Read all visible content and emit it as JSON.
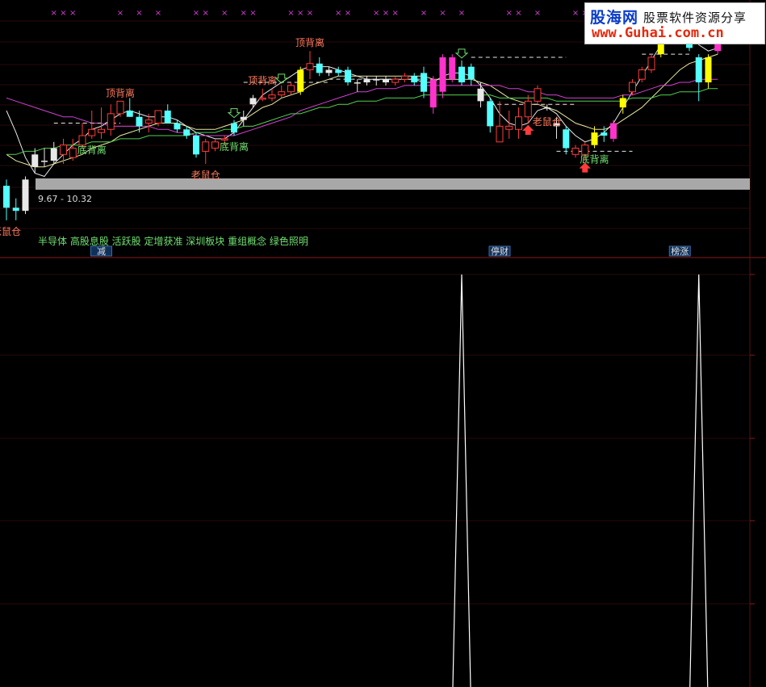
{
  "watermark": {
    "brand": "股海网",
    "tagline": "股票软件资源分享",
    "url": "www.Guhai.com.cn"
  },
  "colors": {
    "background": "#000000",
    "candle_up": "#ff3b3b",
    "candle_down": "#54ffff",
    "candle_strong_up": "#ff33cc",
    "candle_strong_down": "#ffff00",
    "label_red": "#ff7a5c",
    "label_green": "#6fe06f",
    "ma_white": "#e8e8e8",
    "ma_yellow": "#e8e89a",
    "ma_magenta": "#d040d0",
    "ma_green": "#4ed04e",
    "marker_magenta": "#d63bd6",
    "price_band": "#a8a8a8"
  },
  "chart_data": [
    {
      "type": "candlestick",
      "range_label": "9.67 - 10.32",
      "concepts_text": "半导体 高股息股 活跃股 定增获准 深圳板块 重组概念 绿色照明",
      "event_labels": [
        {
          "text": "减",
          "bar": 10,
          "color": "#e0e0e0"
        },
        {
          "text": "停财",
          "bar": 52,
          "color": "#e0e0e0"
        },
        {
          "text": "榜涨",
          "bar": 71,
          "color": "#e0e0e0"
        }
      ],
      "annotations": [
        {
          "text": "顶背离",
          "bar": 12,
          "side": "above",
          "color": "#ff7a5c"
        },
        {
          "text": "顶背离",
          "bar": 27,
          "side": "above",
          "color": "#ff7a5c"
        },
        {
          "text": "顶背离",
          "bar": 32,
          "side": "above",
          "color": "#ff7a5c"
        },
        {
          "text": "底背离",
          "bar": 9,
          "side": "below",
          "color": "#6fe06f"
        },
        {
          "text": "底背离",
          "bar": 24,
          "side": "below",
          "color": "#6fe06f"
        },
        {
          "text": "底背离",
          "bar": 62,
          "side": "below",
          "color": "#6fe06f"
        },
        {
          "text": "老鼠仓",
          "bar": 0,
          "side": "below",
          "color": "#ff7a5c"
        },
        {
          "text": "老鼠仓",
          "bar": 21,
          "side": "below",
          "color": "#ff7a5c"
        },
        {
          "text": "老鼠仓",
          "bar": 57,
          "side": "below",
          "color": "#ff7a5c"
        }
      ],
      "top_marker_bars": [
        5,
        6,
        7,
        12,
        14,
        16,
        20,
        21,
        23,
        25,
        26,
        30,
        31,
        32,
        35,
        36,
        39,
        40,
        41,
        44,
        46,
        48,
        53,
        54,
        56,
        60,
        61,
        66,
        67,
        68,
        69,
        71,
        72,
        73
      ],
      "candles": [
        {
          "o": 9.78,
          "h": 9.8,
          "l": 9.67,
          "c": 9.71,
          "k": "down"
        },
        {
          "o": 9.71,
          "h": 9.74,
          "l": 9.67,
          "c": 9.7,
          "k": "down"
        },
        {
          "o": 9.7,
          "h": 9.81,
          "l": 9.69,
          "c": 9.8,
          "k": "doji"
        },
        {
          "o": 9.84,
          "h": 9.9,
          "l": 9.82,
          "c": 9.88,
          "k": "doji"
        },
        {
          "o": 9.86,
          "h": 9.9,
          "l": 9.84,
          "c": 9.86,
          "k": "doji"
        },
        {
          "o": 9.86,
          "h": 9.92,
          "l": 9.85,
          "c": 9.9,
          "k": "doji"
        },
        {
          "o": 9.88,
          "h": 9.93,
          "l": 9.85,
          "c": 9.91,
          "k": "up"
        },
        {
          "o": 9.87,
          "h": 9.93,
          "l": 9.86,
          "c": 9.9,
          "k": "up"
        },
        {
          "o": 9.91,
          "h": 9.98,
          "l": 9.9,
          "c": 9.94,
          "k": "up"
        },
        {
          "o": 9.94,
          "h": 10.02,
          "l": 9.93,
          "c": 9.96,
          "k": "up"
        },
        {
          "o": 9.96,
          "h": 10.03,
          "l": 9.93,
          "c": 9.95,
          "k": "up"
        },
        {
          "o": 9.96,
          "h": 10.04,
          "l": 9.94,
          "c": 10.01,
          "k": "up"
        },
        {
          "o": 10.01,
          "h": 10.05,
          "l": 10.0,
          "c": 10.05,
          "k": "up"
        },
        {
          "o": 10.02,
          "h": 10.06,
          "l": 10.0,
          "c": 10.0,
          "k": "down"
        },
        {
          "o": 10.0,
          "h": 10.02,
          "l": 9.95,
          "c": 9.97,
          "k": "down"
        },
        {
          "o": 9.98,
          "h": 10.01,
          "l": 9.95,
          "c": 9.99,
          "k": "up"
        },
        {
          "o": 9.98,
          "h": 10.02,
          "l": 9.97,
          "c": 10.02,
          "k": "up"
        },
        {
          "o": 10.02,
          "h": 10.04,
          "l": 9.98,
          "c": 9.98,
          "k": "down"
        },
        {
          "o": 9.98,
          "h": 9.99,
          "l": 9.95,
          "c": 9.96,
          "k": "down"
        },
        {
          "o": 9.96,
          "h": 9.97,
          "l": 9.93,
          "c": 9.94,
          "k": "down"
        },
        {
          "o": 9.94,
          "h": 9.95,
          "l": 9.87,
          "c": 9.88,
          "k": "down"
        },
        {
          "o": 9.89,
          "h": 9.93,
          "l": 9.85,
          "c": 9.92,
          "k": "up"
        },
        {
          "o": 9.9,
          "h": 9.93,
          "l": 9.89,
          "c": 9.92,
          "k": "up"
        },
        {
          "o": 9.93,
          "h": 9.94,
          "l": 9.91,
          "c": 9.93,
          "k": "up"
        },
        {
          "o": 9.95,
          "h": 9.99,
          "l": 9.94,
          "c": 9.98,
          "k": "down"
        },
        {
          "o": 9.99,
          "h": 10.02,
          "l": 9.97,
          "c": 10.0,
          "k": "doji"
        },
        {
          "o": 10.04,
          "h": 10.07,
          "l": 10.03,
          "c": 10.06,
          "k": "doji"
        },
        {
          "o": 10.06,
          "h": 10.09,
          "l": 10.05,
          "c": 10.06,
          "k": "up"
        },
        {
          "o": 10.06,
          "h": 10.09,
          "l": 10.05,
          "c": 10.07,
          "k": "up"
        },
        {
          "o": 10.07,
          "h": 10.1,
          "l": 10.06,
          "c": 10.08,
          "k": "up"
        },
        {
          "o": 10.08,
          "h": 10.11,
          "l": 10.07,
          "c": 10.1,
          "k": "up"
        },
        {
          "o": 10.08,
          "h": 10.16,
          "l": 10.07,
          "c": 10.15,
          "k": "strong_down"
        },
        {
          "o": 10.15,
          "h": 10.21,
          "l": 10.12,
          "c": 10.17,
          "k": "up"
        },
        {
          "o": 10.17,
          "h": 10.19,
          "l": 10.13,
          "c": 10.14,
          "k": "down"
        },
        {
          "o": 10.14,
          "h": 10.16,
          "l": 10.13,
          "c": 10.15,
          "k": "doji"
        },
        {
          "o": 10.15,
          "h": 10.16,
          "l": 10.13,
          "c": 10.14,
          "k": "down"
        },
        {
          "o": 10.15,
          "h": 10.16,
          "l": 10.1,
          "c": 10.11,
          "k": "down"
        },
        {
          "o": 10.11,
          "h": 10.12,
          "l": 10.08,
          "c": 10.11,
          "k": "doji"
        },
        {
          "o": 10.11,
          "h": 10.13,
          "l": 10.1,
          "c": 10.12,
          "k": "doji"
        },
        {
          "o": 10.12,
          "h": 10.13,
          "l": 10.1,
          "c": 10.12,
          "k": "doji"
        },
        {
          "o": 10.12,
          "h": 10.13,
          "l": 10.1,
          "c": 10.11,
          "k": "doji"
        },
        {
          "o": 10.11,
          "h": 10.13,
          "l": 10.1,
          "c": 10.12,
          "k": "up"
        },
        {
          "o": 10.12,
          "h": 10.14,
          "l": 10.11,
          "c": 10.13,
          "k": "up"
        },
        {
          "o": 10.13,
          "h": 10.14,
          "l": 10.1,
          "c": 10.11,
          "k": "down"
        },
        {
          "o": 10.14,
          "h": 10.16,
          "l": 10.06,
          "c": 10.08,
          "k": "down"
        },
        {
          "o": 10.12,
          "h": 10.13,
          "l": 10.01,
          "c": 10.03,
          "k": "strong_up"
        },
        {
          "o": 10.08,
          "h": 10.2,
          "l": 10.06,
          "c": 10.19,
          "k": "strong_up"
        },
        {
          "o": 10.19,
          "h": 10.2,
          "l": 10.11,
          "c": 10.12,
          "k": "strong_up"
        },
        {
          "o": 10.11,
          "h": 10.18,
          "l": 10.1,
          "c": 10.16,
          "k": "down"
        },
        {
          "o": 10.16,
          "h": 10.17,
          "l": 10.1,
          "c": 10.12,
          "k": "down"
        },
        {
          "o": 10.09,
          "h": 10.11,
          "l": 10.03,
          "c": 10.05,
          "k": "doji"
        },
        {
          "o": 10.05,
          "h": 10.06,
          "l": 9.95,
          "c": 9.97,
          "k": "down"
        },
        {
          "o": 9.97,
          "h": 10.05,
          "l": 9.95,
          "c": 9.92,
          "k": "up"
        },
        {
          "o": 9.97,
          "h": 10.02,
          "l": 9.93,
          "c": 9.96,
          "k": "up"
        },
        {
          "o": 9.96,
          "h": 10.03,
          "l": 9.93,
          "c": 10.0,
          "k": "up"
        },
        {
          "o": 10.0,
          "h": 10.07,
          "l": 9.98,
          "c": 10.05,
          "k": "up"
        },
        {
          "o": 10.05,
          "h": 10.1,
          "l": 10.04,
          "c": 10.09,
          "k": "up"
        },
        {
          "o": 10.03,
          "h": 10.04,
          "l": 10.02,
          "c": 10.03,
          "k": "doji"
        },
        {
          "o": 9.98,
          "h": 10.0,
          "l": 9.93,
          "c": 9.97,
          "k": "doji"
        },
        {
          "o": 9.96,
          "h": 9.97,
          "l": 9.88,
          "c": 9.9,
          "k": "down"
        },
        {
          "o": 9.9,
          "h": 9.91,
          "l": 9.87,
          "c": 9.88,
          "k": "up"
        },
        {
          "o": 9.88,
          "h": 9.92,
          "l": 9.86,
          "c": 9.91,
          "k": "up"
        },
        {
          "o": 9.91,
          "h": 9.97,
          "l": 9.9,
          "c": 9.95,
          "k": "strong_down"
        },
        {
          "o": 9.95,
          "h": 9.97,
          "l": 9.92,
          "c": 9.94,
          "k": "down"
        },
        {
          "o": 9.93,
          "h": 9.99,
          "l": 9.92,
          "c": 9.98,
          "k": "strong_up"
        },
        {
          "o": 10.03,
          "h": 10.07,
          "l": 10.01,
          "c": 10.06,
          "k": "strong_down"
        },
        {
          "o": 10.08,
          "h": 10.12,
          "l": 10.07,
          "c": 10.11,
          "k": "up"
        },
        {
          "o": 10.12,
          "h": 10.16,
          "l": 10.11,
          "c": 10.15,
          "k": "up"
        },
        {
          "o": 10.15,
          "h": 10.2,
          "l": 10.14,
          "c": 10.19,
          "k": "up"
        },
        {
          "o": 10.2,
          "h": 10.27,
          "l": 10.19,
          "c": 10.26,
          "k": "strong_down"
        },
        {
          "o": 10.27,
          "h": 10.31,
          "l": 10.24,
          "c": 10.3,
          "k": "up"
        },
        {
          "o": 10.28,
          "h": 10.32,
          "l": 10.25,
          "c": 10.27,
          "k": "up"
        },
        {
          "o": 10.28,
          "h": 10.3,
          "l": 10.21,
          "c": 10.22,
          "k": "down"
        },
        {
          "o": 10.19,
          "h": 10.2,
          "l": 10.05,
          "c": 10.11,
          "k": "down"
        },
        {
          "o": 10.11,
          "h": 10.2,
          "l": 10.09,
          "c": 10.19,
          "k": "strong_down"
        },
        {
          "o": 10.21,
          "h": 10.28,
          "l": 10.2,
          "c": 10.27,
          "k": "strong_up"
        }
      ],
      "moving_averages": [
        {
          "color": "#e8e8e8",
          "values": [
            10.02,
            9.95,
            9.87,
            9.82,
            9.81,
            9.85,
            9.88,
            9.91,
            9.93,
            9.96,
            9.97,
            9.99,
            10.01,
            10.02,
            10.01,
            10.0,
            10.0,
            10.0,
            9.99,
            9.97,
            9.95,
            9.94,
            9.93,
            9.93,
            9.95,
            9.99,
            10.03,
            10.07,
            10.09,
            10.11,
            10.13,
            10.15,
            10.16,
            10.16,
            10.16,
            10.15,
            10.14,
            10.13,
            10.12,
            10.12,
            10.12,
            10.12,
            10.12,
            10.12,
            10.11,
            10.11,
            10.13,
            10.14,
            10.14,
            10.13,
            10.1,
            10.06,
            10.01,
            9.98,
            9.97,
            9.98,
            10.02,
            10.03,
            10.01,
            9.97,
            9.94,
            9.92,
            9.93,
            9.95,
            9.98,
            10.03,
            10.08,
            10.13,
            10.18,
            10.23,
            10.27,
            10.29,
            10.27,
            10.23,
            10.21,
            10.22
          ]
        },
        {
          "color": "#e8e8a0",
          "values": [
            9.88,
            9.86,
            9.85,
            9.84,
            9.84,
            9.85,
            9.86,
            9.87,
            9.88,
            9.9,
            9.91,
            9.92,
            9.94,
            9.95,
            9.96,
            9.97,
            9.98,
            9.98,
            9.98,
            9.97,
            9.96,
            9.96,
            9.96,
            9.97,
            9.98,
            9.99,
            10.01,
            10.03,
            10.04,
            10.06,
            10.07,
            10.08,
            10.1,
            10.11,
            10.12,
            10.13,
            10.13,
            10.13,
            10.13,
            10.13,
            10.13,
            10.13,
            10.13,
            10.13,
            10.13,
            10.12,
            10.12,
            10.12,
            10.12,
            10.12,
            10.11,
            10.1,
            10.08,
            10.06,
            10.05,
            10.04,
            10.04,
            10.03,
            10.02,
            10.0,
            9.98,
            9.97,
            9.96,
            9.96,
            9.97,
            9.99,
            10.01,
            10.03,
            10.06,
            10.09,
            10.12,
            10.15,
            10.17,
            10.18,
            10.19,
            10.2
          ]
        },
        {
          "color": "#d040d0",
          "values": [
            10.06,
            10.05,
            10.04,
            10.03,
            10.02,
            10.01,
            10.0,
            10.0,
            9.99,
            9.98,
            9.98,
            9.97,
            9.97,
            9.97,
            9.97,
            9.97,
            9.96,
            9.96,
            9.95,
            9.95,
            9.94,
            9.94,
            9.94,
            9.94,
            9.94,
            9.95,
            9.96,
            9.97,
            9.98,
            9.99,
            10.0,
            10.02,
            10.03,
            10.04,
            10.05,
            10.06,
            10.07,
            10.08,
            10.08,
            10.09,
            10.09,
            10.09,
            10.1,
            10.1,
            10.1,
            10.1,
            10.1,
            10.1,
            10.1,
            10.1,
            10.1,
            10.1,
            10.1,
            10.09,
            10.09,
            10.08,
            10.08,
            10.07,
            10.07,
            10.06,
            10.06,
            10.06,
            10.06,
            10.06,
            10.06,
            10.07,
            10.07,
            10.08,
            10.09,
            10.1,
            10.1,
            10.11,
            10.11,
            10.12,
            10.12,
            10.12
          ]
        },
        {
          "color": "#4ed04e",
          "values": [
            9.88,
            9.88,
            9.89,
            9.89,
            9.9,
            9.9,
            9.91,
            9.91,
            9.91,
            9.92,
            9.92,
            9.92,
            9.93,
            9.93,
            9.93,
            9.94,
            9.94,
            9.94,
            9.94,
            9.94,
            9.95,
            9.95,
            9.95,
            9.96,
            9.96,
            9.97,
            9.97,
            9.98,
            9.99,
            10.0,
            10.01,
            10.01,
            10.02,
            10.03,
            10.03,
            10.04,
            10.04,
            10.05,
            10.05,
            10.05,
            10.06,
            10.06,
            10.06,
            10.06,
            10.07,
            10.07,
            10.07,
            10.07,
            10.07,
            10.07,
            10.07,
            10.07,
            10.06,
            10.06,
            10.06,
            10.06,
            10.06,
            10.06,
            10.05,
            10.05,
            10.05,
            10.05,
            10.05,
            10.05,
            10.05,
            10.05,
            10.06,
            10.06,
            10.06,
            10.07,
            10.07,
            10.08,
            10.08,
            10.08,
            10.09,
            10.09
          ]
        }
      ],
      "dashed_levels": [
        {
          "price": 10.11,
          "from_bar": 25,
          "to_bar": 34
        },
        {
          "price": 10.12,
          "from_bar": 34,
          "to_bar": 45
        },
        {
          "price": 10.19,
          "from_bar": 49,
          "to_bar": 59
        },
        {
          "price": 10.04,
          "from_bar": 51,
          "to_bar": 60
        },
        {
          "price": 9.89,
          "from_bar": 58,
          "to_bar": 66
        },
        {
          "price": 10.2,
          "from_bar": 67,
          "to_bar": 72
        },
        {
          "price": 9.98,
          "from_bar": 5,
          "to_bar": 12
        }
      ],
      "arrows": [
        {
          "bar": 24,
          "dir": "down",
          "color": "#6fe06f"
        },
        {
          "bar": 29,
          "dir": "down",
          "color": "#6fe06f"
        },
        {
          "bar": 48,
          "dir": "down",
          "color": "#6fe06f"
        },
        {
          "bar": 55,
          "dir": "up",
          "color": "#ff3b3b"
        },
        {
          "bar": 61,
          "dir": "up",
          "color": "#ff3b3b"
        }
      ],
      "ylim": [
        9.6,
        10.36
      ]
    },
    {
      "type": "line",
      "series": [
        {
          "color": "#ffffff",
          "peaks": [
            {
              "bar": 48,
              "value": 1
            },
            {
              "bar": 73,
              "value": 1
            }
          ]
        }
      ],
      "ylim": [
        0,
        1
      ]
    }
  ]
}
